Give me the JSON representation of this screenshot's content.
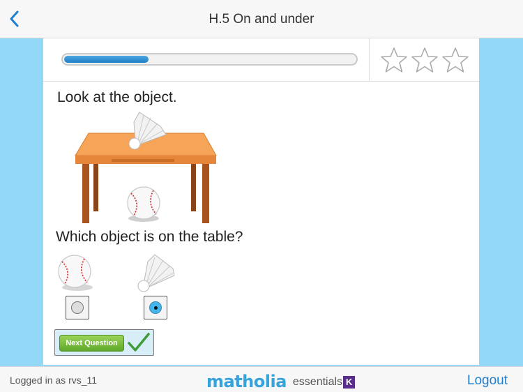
{
  "header": {
    "title": "H.5 On and under"
  },
  "progress": {
    "fraction": 0.29
  },
  "stars": {
    "earned": 0,
    "total": 3
  },
  "question": {
    "prompt": "Look at the object.",
    "ask": "Which object is on the table?",
    "options": [
      {
        "object": "baseball",
        "selected": false
      },
      {
        "object": "shuttlecock",
        "selected": true
      }
    ]
  },
  "actions": {
    "next_label": "Next Question"
  },
  "footer": {
    "logged_in": "Logged in as rvs_11",
    "logo_main": "matholia",
    "logo_sub": "essentials",
    "logo_k": "K",
    "logout": "Logout"
  },
  "colors": {
    "accent": "#1e7fd0",
    "background": "#93d9f7",
    "progress": "#2b8fd6",
    "next_button": "#6fb733"
  }
}
